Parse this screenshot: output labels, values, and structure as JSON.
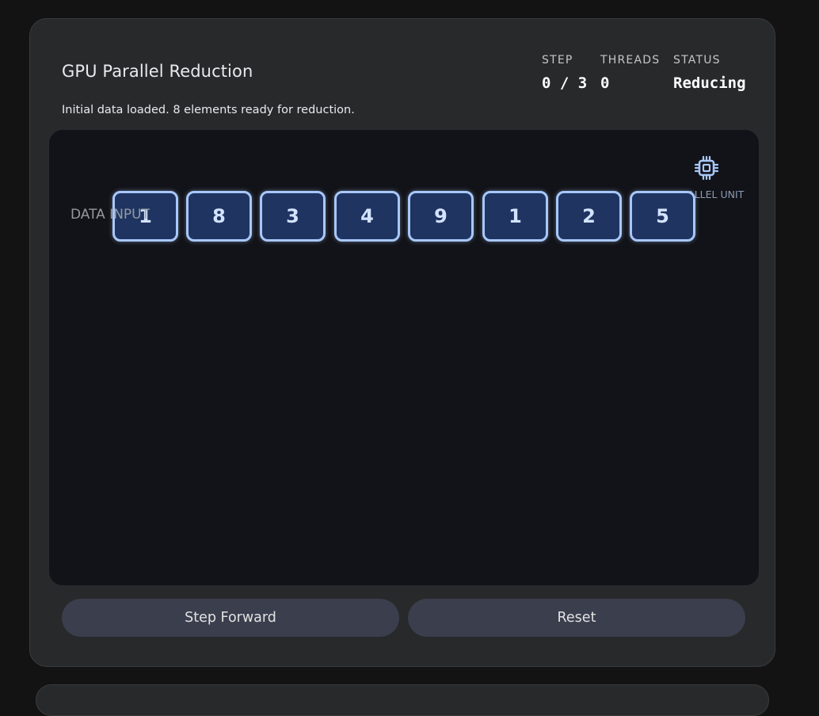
{
  "title": "GPU Parallel Reduction",
  "message": "Initial data loaded. 8 elements ready for reduction.",
  "stats": {
    "step": {
      "label": "STEP",
      "value": "0 / 3"
    },
    "threads": {
      "label": "THREADS",
      "value": "0"
    },
    "status": {
      "label": "STATUS",
      "value": "Reducing"
    }
  },
  "stage": {
    "data_label": "DATA INPUT",
    "cells": [
      "1",
      "8",
      "3",
      "4",
      "9",
      "1",
      "2",
      "5"
    ],
    "unit_label": "PARALLEL UNIT",
    "unit_icon": "chip-icon",
    "accent": "#a8c7fa",
    "cell_fill": "#1f3461"
  },
  "controls": {
    "step_label": "Step Forward",
    "reset_label": "Reset"
  }
}
